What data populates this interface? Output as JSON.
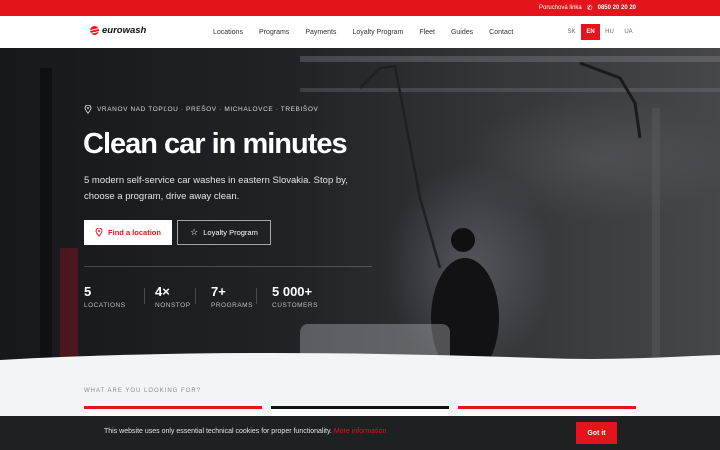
{
  "topbar": {
    "label": "Poruchová linka",
    "phone": "0850 20 20 20"
  },
  "header": {
    "logo": "eurowash",
    "nav": [
      "Locations",
      "Programs",
      "Payments",
      "Loyalty Program",
      "Fleet",
      "Guides",
      "Contact"
    ],
    "langs": [
      "SK",
      "EN",
      "HU",
      "UA"
    ],
    "active_lang": "EN"
  },
  "hero": {
    "eyebrow": "VRANOV NAD TOPĽOU · PREŠOV · MICHALOVCE · TREBIŠOV",
    "title": "Clean car in minutes",
    "subtitle": "5 modern self-service car washes in eastern Slovakia. Stop by, choose a program, drive away clean.",
    "cta_primary": "Find a location",
    "cta_secondary": "Loyalty Program",
    "stats": [
      {
        "value": "5",
        "label": "LOCATIONS"
      },
      {
        "value": "4×",
        "label": "NONSTOP"
      },
      {
        "value": "7+",
        "label": "PROGRAMS"
      },
      {
        "value": "5 000+",
        "label": "CUSTOMERS"
      }
    ]
  },
  "section": {
    "label": "WHAT ARE YOU LOOKING FOR?"
  },
  "cookie": {
    "text": "This website uses only essential technical cookies for proper functionality.",
    "link": "More information",
    "button": "Got it"
  },
  "colors": {
    "brand": "#e3141b",
    "dark": "#1f2022"
  }
}
